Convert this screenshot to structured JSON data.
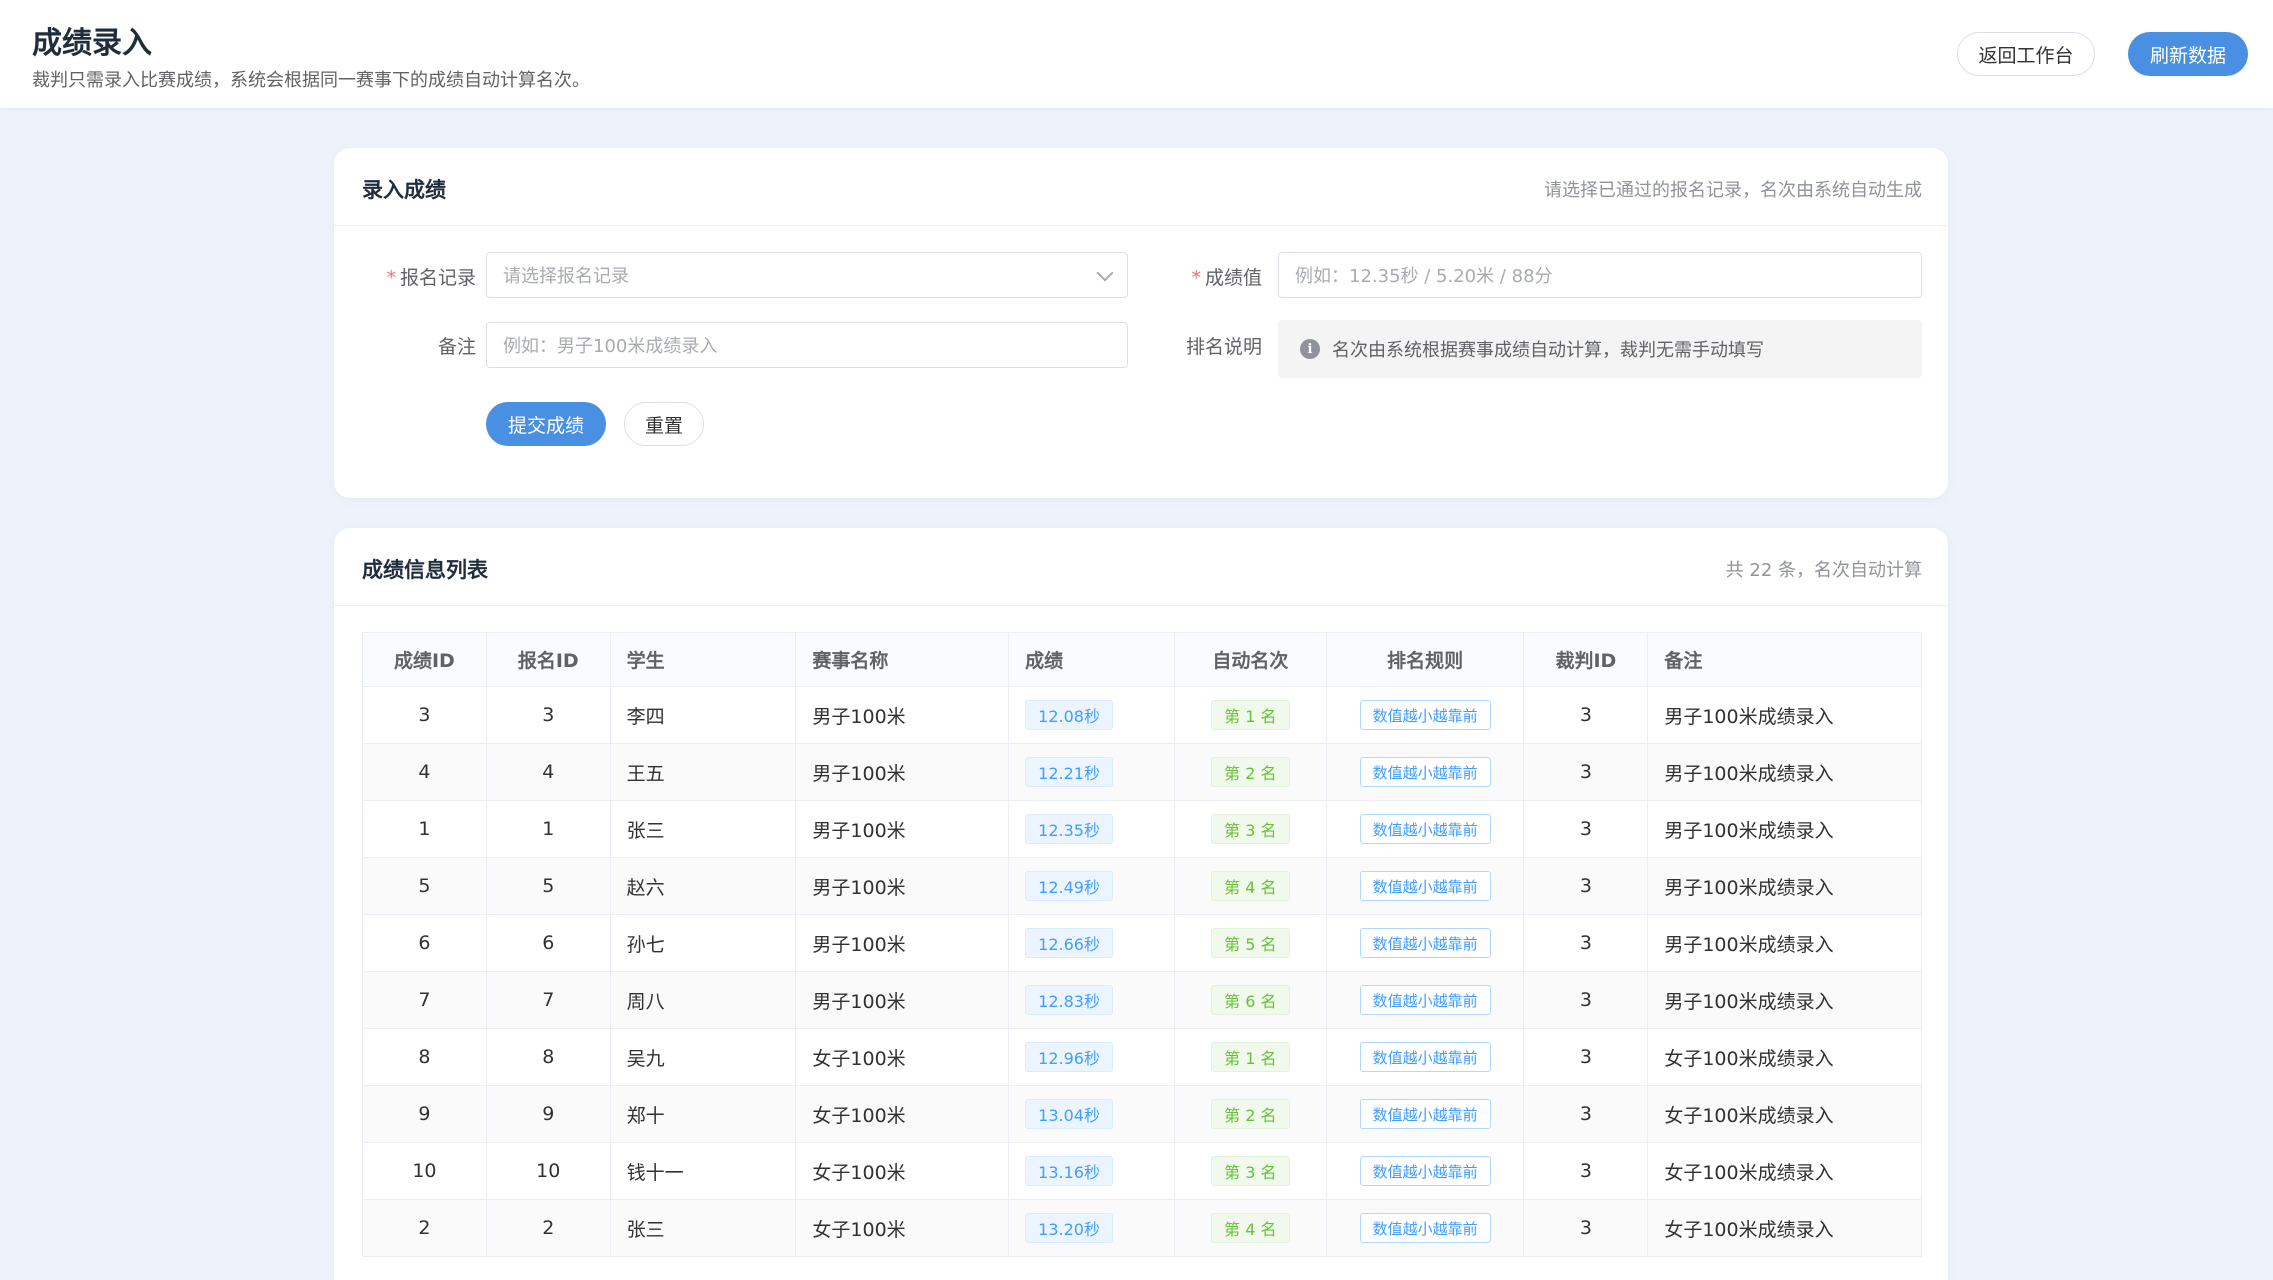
{
  "header": {
    "title": "成绩录入",
    "subtitle": "裁判只需录入比赛成绩，系统会根据同一赛事下的成绩自动计算名次。",
    "back_label": "返回工作台",
    "refresh_label": "刷新数据"
  },
  "entry": {
    "title": "录入成绩",
    "hint": "请选择已通过的报名记录，名次由系统自动生成",
    "signup_label": "报名记录",
    "signup_placeholder": "请选择报名记录",
    "score_label": "成绩值",
    "score_placeholder": "例如：12.35秒 / 5.20米 / 88分",
    "remark_label": "备注",
    "remark_placeholder": "例如：男子100米成绩录入",
    "rank_label": "排名说明",
    "rank_tip": "名次由系统根据赛事成绩自动计算，裁判无需手动填写",
    "submit_label": "提交成绩",
    "reset_label": "重置"
  },
  "list": {
    "title": "成绩信息列表",
    "summary": "共 22 条，名次自动计算",
    "columns": [
      "成绩ID",
      "报名ID",
      "学生",
      "赛事名称",
      "成绩",
      "自动名次",
      "排名规则",
      "裁判ID",
      "备注"
    ],
    "rows": [
      {
        "id": "3",
        "signup": "3",
        "student": "李四",
        "event": "男子100米",
        "score": "12.08秒",
        "rank": "第 1 名",
        "rule": "数值越小越靠前",
        "judge": "3",
        "remark": "男子100米成绩录入"
      },
      {
        "id": "4",
        "signup": "4",
        "student": "王五",
        "event": "男子100米",
        "score": "12.21秒",
        "rank": "第 2 名",
        "rule": "数值越小越靠前",
        "judge": "3",
        "remark": "男子100米成绩录入"
      },
      {
        "id": "1",
        "signup": "1",
        "student": "张三",
        "event": "男子100米",
        "score": "12.35秒",
        "rank": "第 3 名",
        "rule": "数值越小越靠前",
        "judge": "3",
        "remark": "男子100米成绩录入"
      },
      {
        "id": "5",
        "signup": "5",
        "student": "赵六",
        "event": "男子100米",
        "score": "12.49秒",
        "rank": "第 4 名",
        "rule": "数值越小越靠前",
        "judge": "3",
        "remark": "男子100米成绩录入"
      },
      {
        "id": "6",
        "signup": "6",
        "student": "孙七",
        "event": "男子100米",
        "score": "12.66秒",
        "rank": "第 5 名",
        "rule": "数值越小越靠前",
        "judge": "3",
        "remark": "男子100米成绩录入"
      },
      {
        "id": "7",
        "signup": "7",
        "student": "周八",
        "event": "男子100米",
        "score": "12.83秒",
        "rank": "第 6 名",
        "rule": "数值越小越靠前",
        "judge": "3",
        "remark": "男子100米成绩录入"
      },
      {
        "id": "8",
        "signup": "8",
        "student": "吴九",
        "event": "女子100米",
        "score": "12.96秒",
        "rank": "第 1 名",
        "rule": "数值越小越靠前",
        "judge": "3",
        "remark": "女子100米成绩录入"
      },
      {
        "id": "9",
        "signup": "9",
        "student": "郑十",
        "event": "女子100米",
        "score": "13.04秒",
        "rank": "第 2 名",
        "rule": "数值越小越靠前",
        "judge": "3",
        "remark": "女子100米成绩录入"
      },
      {
        "id": "10",
        "signup": "10",
        "student": "钱十一",
        "event": "女子100米",
        "score": "13.16秒",
        "rank": "第 3 名",
        "rule": "数值越小越靠前",
        "judge": "3",
        "remark": "女子100米成绩录入"
      },
      {
        "id": "2",
        "signup": "2",
        "student": "张三",
        "event": "女子100米",
        "score": "13.20秒",
        "rank": "第 4 名",
        "rule": "数值越小越靠前",
        "judge": "3",
        "remark": "女子100米成绩录入"
      }
    ]
  },
  "colors": {
    "primary": "#4a90e2",
    "background": "#eef3fb",
    "score_tag": "#409eff",
    "rank_tag": "#67c23a"
  }
}
